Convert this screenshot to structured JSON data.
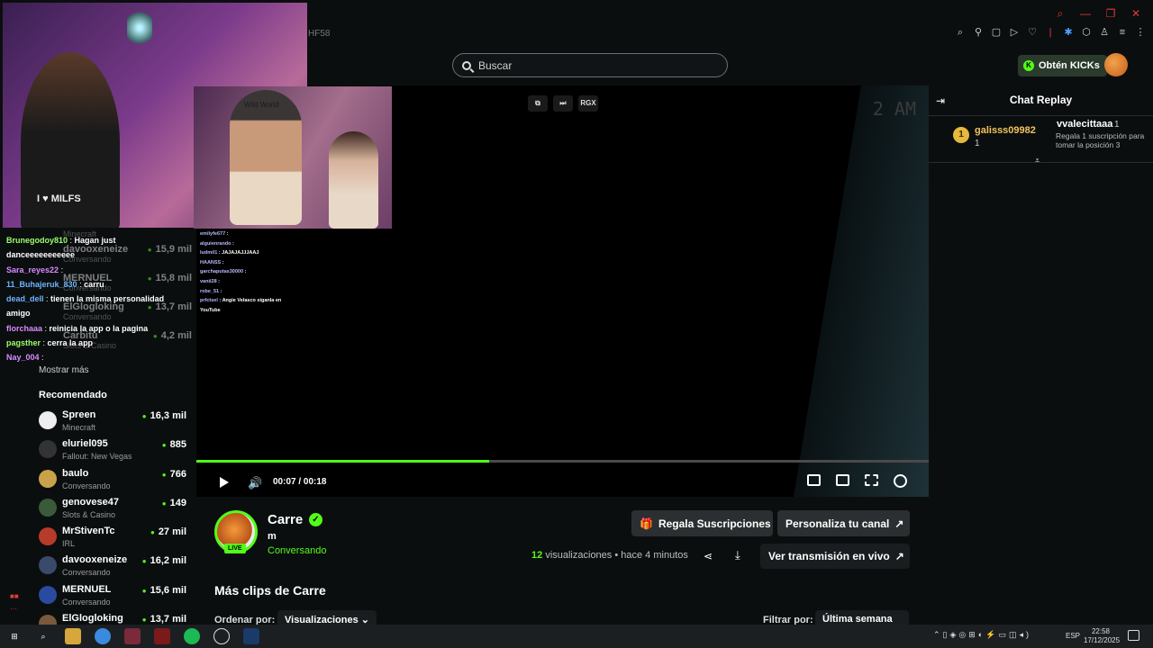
{
  "topbar": {
    "ghost_code": "HF58",
    "search_placeholder": "Buscar",
    "kicks_label": "Obtén KICKs"
  },
  "webcam": {
    "shirt_text": "I ♥ MILFS",
    "hat_text": "Wild World"
  },
  "overlay_chat": [
    {
      "user": "Brunegodoy810",
      "color": "#9dff6a",
      "text": "Hagan just"
    },
    {
      "user": "",
      "color": "#ffffff",
      "text": "danceeeeeeeeeee"
    },
    {
      "user": "Sara_reyes22",
      "color": "#d88bff",
      "text": ""
    },
    {
      "user": "11_Buhajeruk_830",
      "color": "#6db4ff",
      "text": "carru"
    },
    {
      "user": "dead_dell",
      "color": "#6db4ff",
      "text": "tienen la misma personalidad"
    },
    {
      "user": "",
      "color": "#ffffff",
      "text": "amigo"
    },
    {
      "user": "florchaaa",
      "color": "#d88bff",
      "text": "reinicia la app o la pagina"
    },
    {
      "user": "pagsther",
      "color": "#9dff6a",
      "text": "cerra la app"
    },
    {
      "user": "Nay_004",
      "color": "#d88bff",
      "text": ""
    }
  ],
  "sidebar": {
    "followed": [
      {
        "name": "",
        "category": "Minecraft",
        "viewers": ""
      },
      {
        "name": "davooxeneize",
        "category": "Conversando",
        "viewers": "15,9 mil"
      },
      {
        "name": "MERNUEL",
        "category": "Conversando",
        "viewers": "15,8 mil"
      },
      {
        "name": "ElGlogloking",
        "category": "Conversando",
        "viewers": "13,7 mil"
      },
      {
        "name": "Carbitu",
        "category": "Slots & Casino",
        "viewers": "4,2 mil"
      }
    ],
    "show_more": "Mostrar más",
    "recommended_title": "Recomendado",
    "recommended": [
      {
        "name": "Spreen",
        "category": "Minecraft",
        "viewers": "16,3 mil",
        "color": "#eeeeee"
      },
      {
        "name": "eluriel095",
        "category": "Fallout: New Vegas",
        "viewers": "885",
        "color": "#333333"
      },
      {
        "name": "baulo",
        "category": "Conversando",
        "viewers": "766",
        "color": "#c9a24a"
      },
      {
        "name": "genovese47",
        "category": "Slots & Casino",
        "viewers": "149",
        "color": "#3a5a3a"
      },
      {
        "name": "MrStivenTc",
        "category": "IRL",
        "viewers": "27 mil",
        "color": "#b83a2a"
      },
      {
        "name": "davooxeneize",
        "category": "Conversando",
        "viewers": "16,2 mil",
        "color": "#3a4a6a"
      },
      {
        "name": "MERNUEL",
        "category": "Conversando",
        "viewers": "15,6 mil",
        "color": "#2a4aa0"
      },
      {
        "name": "ElGlogloking",
        "category": "",
        "viewers": "13,7 mil",
        "color": "#7a5a3a"
      }
    ]
  },
  "player": {
    "time_label": "2 AM",
    "top_controls": [
      "⧉",
      "⏭",
      "RGX"
    ],
    "stream_chat": [
      {
        "user": "emilyfe677",
        "text": ""
      },
      {
        "user": "alguienrando",
        "text": ""
      },
      {
        "user": "ludmil1",
        "text": "JAJAJAJJJAAJ"
      },
      {
        "user": "HAANSS",
        "text": ""
      },
      {
        "user": "garchaputas30000",
        "text": ""
      },
      {
        "user": "vanii28",
        "text": ""
      },
      {
        "user": "robe_51",
        "text": ""
      },
      {
        "user": "prfctsel",
        "text": "Angie Velasco siganla en"
      },
      {
        "user": "",
        "text": "YouTube"
      }
    ],
    "current_time": "00:07",
    "duration": "00:18",
    "progress": 0.4
  },
  "channel": {
    "name": "Carre",
    "live_badge": "LIVE",
    "title": "m",
    "category": "Conversando",
    "gift_button": "Regala Suscripciones",
    "customize_button": "Personaliza tu canal",
    "views_count": "12",
    "views_label": "visualizaciones",
    "time_ago": "• hace 4 minutos",
    "watch_live_button": "Ver transmisión en vivo"
  },
  "clips": {
    "title": "Más clips de Carre",
    "sort_label": "Ordenar por:",
    "sort_value": "Visualizaciones",
    "filter_label": "Filtrar por:",
    "filter_value": "Última semana"
  },
  "chat_replay": {
    "title": "Chat Replay",
    "pinned_rank": "1",
    "pinned_user1": "galisss09982",
    "pinned_user1_count": "1",
    "pinned_user2": "vvalecittaaa",
    "pinned_user2_count": "1",
    "pinned_desc": "Regala 1 suscripción para tomar la posición 3"
  },
  "taskbar": {
    "lang": "ESP",
    "time": "22:58",
    "date": "17/12/2025"
  }
}
